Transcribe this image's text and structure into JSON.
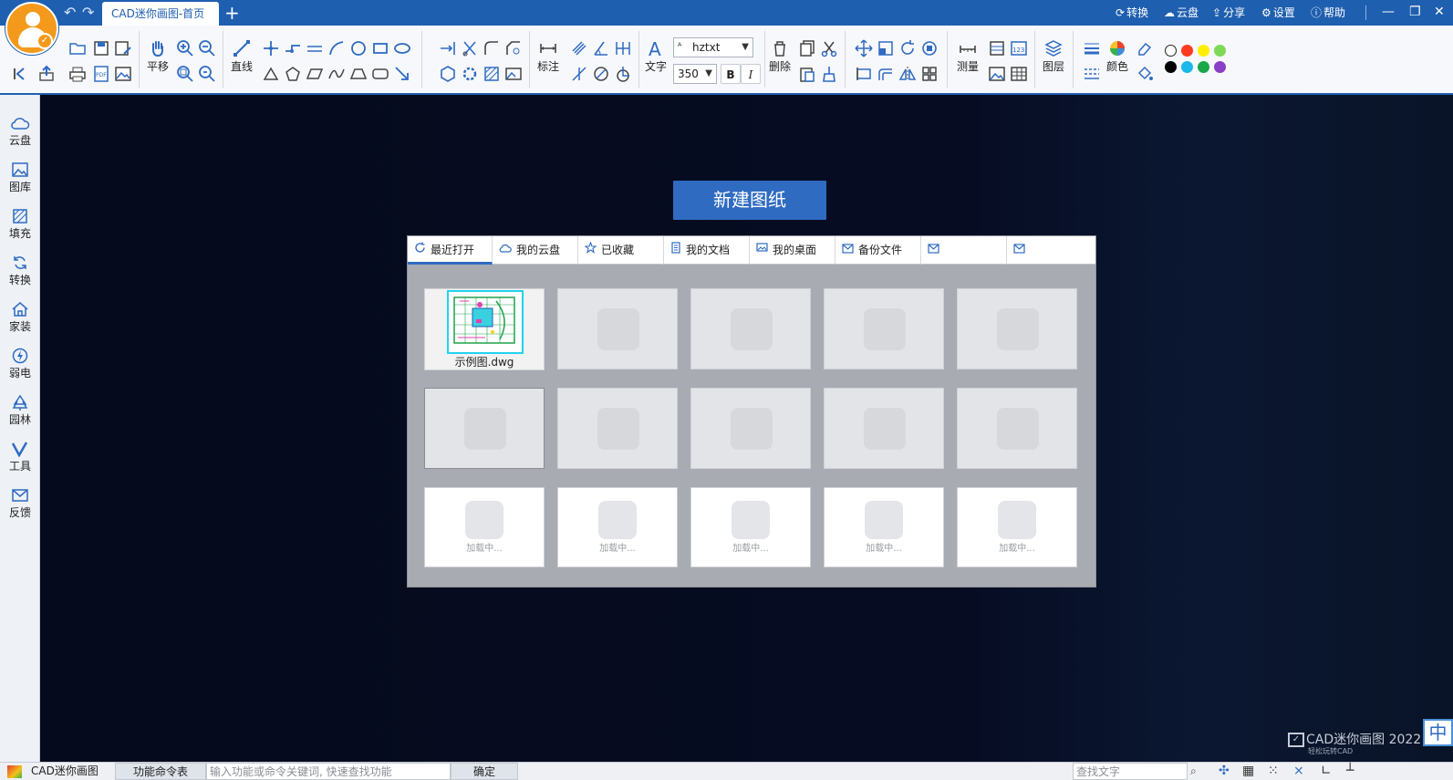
{
  "window": {
    "tab_title": "CAD迷你画图-首页",
    "new_tab": "+",
    "title_actions": [
      {
        "icon": "convert-icon",
        "label": "转换"
      },
      {
        "icon": "cloud-icon",
        "label": "云盘"
      },
      {
        "icon": "share-icon",
        "label": "分享"
      },
      {
        "icon": "gear-icon",
        "label": "设置"
      },
      {
        "icon": "help-icon",
        "label": "帮助"
      }
    ]
  },
  "ribbon": {
    "pan_label": "平移",
    "line_label": "直线",
    "dim_label": "标注",
    "text_label": "文字",
    "font_value": "hztxt",
    "size_value": "350",
    "bold": "B",
    "italic": "I",
    "delete_label": "删除",
    "measure_label": "测量",
    "layer_label": "图层",
    "color_label": "颜色",
    "swatches": [
      "#ffffff",
      "#ff3b1f",
      "#ffee00",
      "#7ed957",
      "#000000",
      "#1ab7ea",
      "#19a74a",
      "#8a3fc7"
    ]
  },
  "sidebar": {
    "items": [
      {
        "icon": "cloud-icon",
        "label": "云盘"
      },
      {
        "icon": "gallery-icon",
        "label": "图库"
      },
      {
        "icon": "hatch-icon",
        "label": "填充"
      },
      {
        "icon": "convert-icon",
        "label": "转换"
      },
      {
        "icon": "home-icon",
        "label": "家装"
      },
      {
        "icon": "lightning-icon",
        "label": "弱电"
      },
      {
        "icon": "tree-icon",
        "label": "园林"
      },
      {
        "icon": "tools-icon",
        "label": "工具"
      },
      {
        "icon": "mail-icon",
        "label": "反馈"
      }
    ]
  },
  "start": {
    "new_drawing": "新建图纸",
    "tabs": [
      {
        "icon": "refresh-icon",
        "label": "最近打开"
      },
      {
        "icon": "cloud-icon",
        "label": "我的云盘"
      },
      {
        "icon": "star-icon",
        "label": "已收藏"
      },
      {
        "icon": "document-icon",
        "label": "我的文档"
      },
      {
        "icon": "desktop-icon",
        "label": "我的桌面"
      },
      {
        "icon": "mail-icon",
        "label": "备份文件"
      },
      {
        "icon": "mail-icon",
        "label": ""
      },
      {
        "icon": "mail-icon",
        "label": ""
      }
    ],
    "recent_file": "示例图.dwg",
    "loading_text": "加载中..."
  },
  "watermark": {
    "brand": "CAD迷你画图 2022 R",
    "slogan": "轻松玩转CAD"
  },
  "ime": "中",
  "status": {
    "app_name": "CAD迷你画图",
    "command_table": "功能命令表",
    "search_placeholder": "输入功能或命令关键词, 快速查找功能",
    "confirm": "确定",
    "find_text_placeholder": "查找文字"
  }
}
